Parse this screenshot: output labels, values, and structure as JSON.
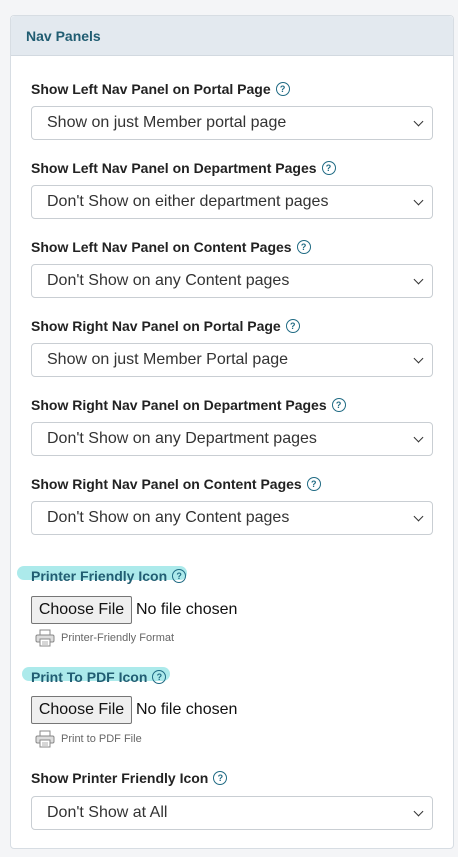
{
  "panel": {
    "title": "Nav Panels"
  },
  "fields": [
    {
      "label": "Show Left Nav Panel on Portal Page",
      "value": "Show on just Member portal page"
    },
    {
      "label": "Show Left Nav Panel on Department Pages",
      "value": "Don't Show on either department pages"
    },
    {
      "label": "Show Left Nav Panel on Content Pages",
      "value": "Don't Show on any Content pages"
    },
    {
      "label": "Show Right Nav Panel on Portal Page",
      "value": "Show on just Member Portal page"
    },
    {
      "label": "Show Right Nav Panel on Department Pages",
      "value": "Don't Show on any Department pages"
    },
    {
      "label": "Show Right Nav Panel on Content Pages",
      "value": "Don't Show on any Content pages"
    }
  ],
  "printer_icon": {
    "label": "Printer Friendly Icon",
    "button": "Choose File",
    "status": "No file chosen",
    "caption": "Printer-Friendly Format"
  },
  "pdf_icon": {
    "label": "Print To PDF Icon",
    "button": "Choose File",
    "status": "No file chosen",
    "caption": "Print to PDF File"
  },
  "show_printer": {
    "label": "Show Printer Friendly Icon",
    "value": "Don't Show at All"
  },
  "help_glyph": "?",
  "colors": {
    "accent": "#215d72",
    "highlight": "#9ee6e8",
    "header_bg": "#e3e9ef"
  }
}
